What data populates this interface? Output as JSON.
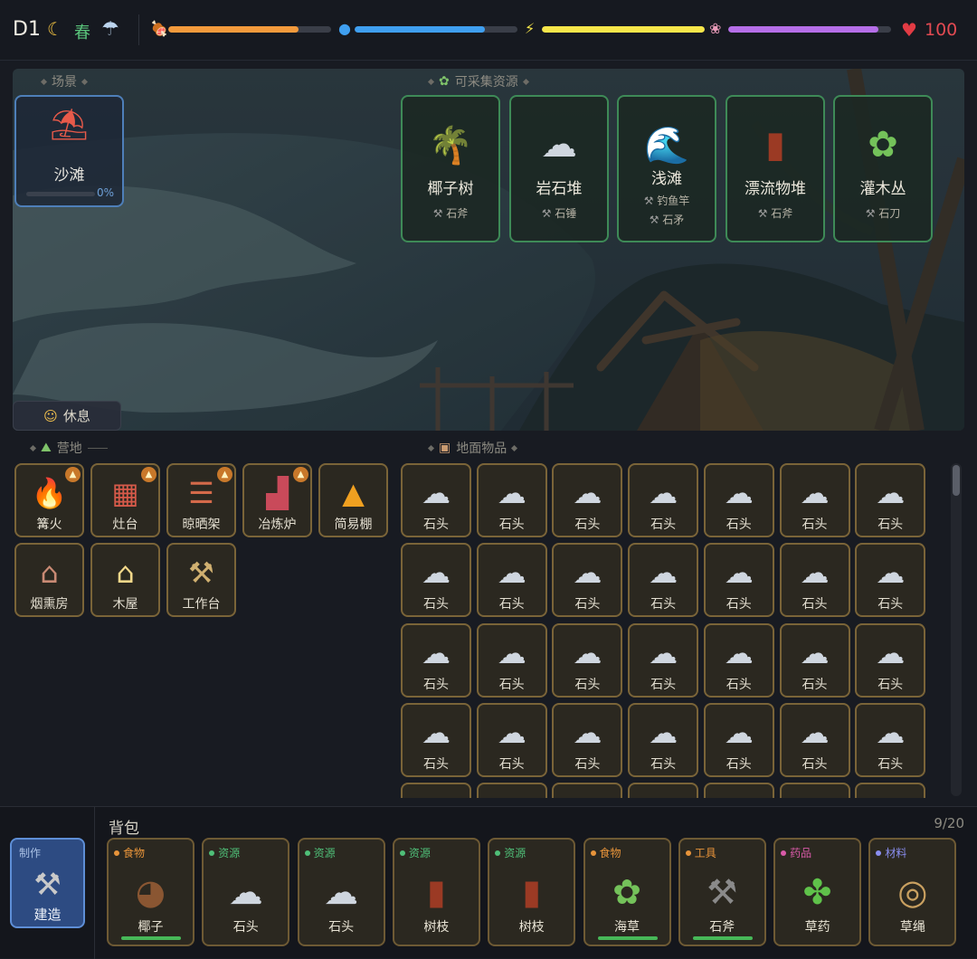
{
  "top": {
    "day": "D1",
    "time_icon": "moon-icon",
    "season": "春",
    "weather_icon": "rain-cloud-icon",
    "hp": "100",
    "stats": [
      {
        "icon": "meat-icon",
        "glyph": "🍖",
        "fraction": 0.8,
        "color": "#f39a3c"
      },
      {
        "icon": "water-icon",
        "glyph": "💧",
        "fraction": 0.8,
        "color": "#3f9ff0"
      },
      {
        "icon": "energy-icon",
        "glyph": "⚡",
        "fraction": 1.0,
        "color": "#f7e64a"
      },
      {
        "icon": "brain-icon",
        "glyph": "🧠",
        "fraction": 0.92,
        "color": "#b56ee8"
      }
    ]
  },
  "scene": {
    "title": "场景",
    "location": {
      "icon": "beach-umbrella-icon",
      "glyph": "🏖️",
      "name": "沙滩",
      "progress": "0%"
    },
    "resources_title": "可采集资源",
    "resources": [
      {
        "icon": "palm-tree-icon",
        "glyph": "🌴",
        "name": "椰子树",
        "tools": [
          "石斧"
        ]
      },
      {
        "icon": "rock-icon",
        "glyph": "🪨",
        "name": "岩石堆",
        "tools": [
          "石锤"
        ]
      },
      {
        "icon": "wave-icon",
        "glyph": "🌊",
        "name": "浅滩",
        "tools": [
          "钓鱼竿",
          "石矛"
        ]
      },
      {
        "icon": "wood-icon",
        "glyph": "🪵",
        "name": "漂流物堆",
        "tools": [
          "石斧"
        ]
      },
      {
        "icon": "herb-icon",
        "glyph": "🌿",
        "name": "灌木丛",
        "tools": [
          "石刀"
        ]
      }
    ],
    "rest_label": "休息"
  },
  "camp": {
    "title": "营地",
    "items": [
      {
        "icon": "fire-icon",
        "glyph": "🔥",
        "name": "篝火",
        "lit": true
      },
      {
        "icon": "brick-icon",
        "glyph": "🧱",
        "name": "灶台",
        "lit": true
      },
      {
        "icon": "ladder-icon",
        "glyph": "🪜",
        "name": "晾晒架",
        "lit": true
      },
      {
        "icon": "factory-icon",
        "glyph": "🏭",
        "name": "冶炼炉",
        "lit": true
      },
      {
        "icon": "tent-icon",
        "glyph": "⛺",
        "name": "简易棚",
        "lit": false
      },
      {
        "icon": "derelict-house-icon",
        "glyph": "🏚️",
        "name": "烟熏房",
        "lit": false
      },
      {
        "icon": "house-icon",
        "glyph": "🏠",
        "name": "木屋",
        "lit": false
      },
      {
        "icon": "hammer-icon",
        "glyph": "🔨",
        "name": "工作台",
        "lit": false
      }
    ]
  },
  "ground": {
    "title": "地面物品",
    "items": [
      "石头",
      "石头",
      "石头",
      "石头",
      "石头",
      "石头",
      "石头",
      "石头",
      "石头",
      "石头",
      "石头",
      "石头",
      "石头",
      "石头",
      "石头",
      "石头",
      "石头",
      "石头",
      "石头",
      "石头",
      "石头",
      "石头",
      "石头",
      "石头",
      "石头",
      "石头",
      "石头",
      "石头"
    ],
    "item_icon": "rock-icon"
  },
  "bottom": {
    "craft_tag": "制作",
    "craft_label": "建造",
    "bag_title": "背包",
    "bag_count": "9/20",
    "items": [
      {
        "cat": "食物",
        "cat_color": "#e8943a",
        "icon": "coconut-icon",
        "glyph": "🥥",
        "name": "椰子",
        "durability": true
      },
      {
        "cat": "资源",
        "cat_color": "#4fbf78",
        "icon": "rock-icon",
        "glyph": "🪨",
        "name": "石头",
        "durability": false
      },
      {
        "cat": "资源",
        "cat_color": "#4fbf78",
        "icon": "rock-icon",
        "glyph": "🪨",
        "name": "石头",
        "durability": false
      },
      {
        "cat": "资源",
        "cat_color": "#4fbf78",
        "icon": "wood-icon",
        "glyph": "🪵",
        "name": "树枝",
        "durability": false
      },
      {
        "cat": "资源",
        "cat_color": "#4fbf78",
        "icon": "wood-icon",
        "glyph": "🪵",
        "name": "树枝",
        "durability": false
      },
      {
        "cat": "食物",
        "cat_color": "#e8943a",
        "icon": "herb-icon",
        "glyph": "🌿",
        "name": "海草",
        "durability": true
      },
      {
        "cat": "工具",
        "cat_color": "#e8943a",
        "icon": "axe-icon",
        "glyph": "🪓",
        "name": "石斧",
        "durability": true
      },
      {
        "cat": "药品",
        "cat_color": "#d95aa8",
        "icon": "seedling-icon",
        "glyph": "🌱",
        "name": "草药",
        "durability": false
      },
      {
        "cat": "材料",
        "cat_color": "#8a8ef0",
        "icon": "rope-icon",
        "glyph": "🪢",
        "name": "草绳",
        "durability": false
      }
    ]
  }
}
